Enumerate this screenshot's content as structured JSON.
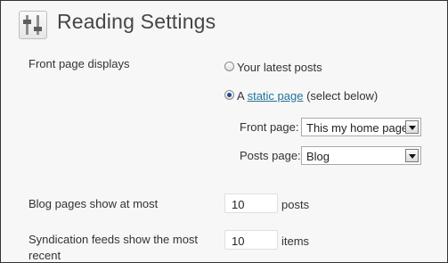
{
  "header": {
    "title": "Reading Settings",
    "icon": "settings-sliders-icon"
  },
  "front_page_displays": {
    "label": "Front page displays",
    "options": [
      {
        "label": "Your latest posts",
        "checked": false
      },
      {
        "prefix": "A ",
        "link": "static page",
        "suffix": " (select below)",
        "checked": true
      }
    ],
    "front_page": {
      "label": "Front page:",
      "selected": "This my home page"
    },
    "posts_page": {
      "label": "Posts page:",
      "selected": "Blog"
    }
  },
  "blog_pages": {
    "label": "Blog pages show at most",
    "value": "10",
    "unit": "posts"
  },
  "syndication": {
    "label_line1": "Syndication feeds show the most",
    "label_line2": "recent",
    "value": "10",
    "unit": "items"
  },
  "colors": {
    "link": "#21759b",
    "title": "#464646",
    "radio_dot": "#1b4a96"
  }
}
